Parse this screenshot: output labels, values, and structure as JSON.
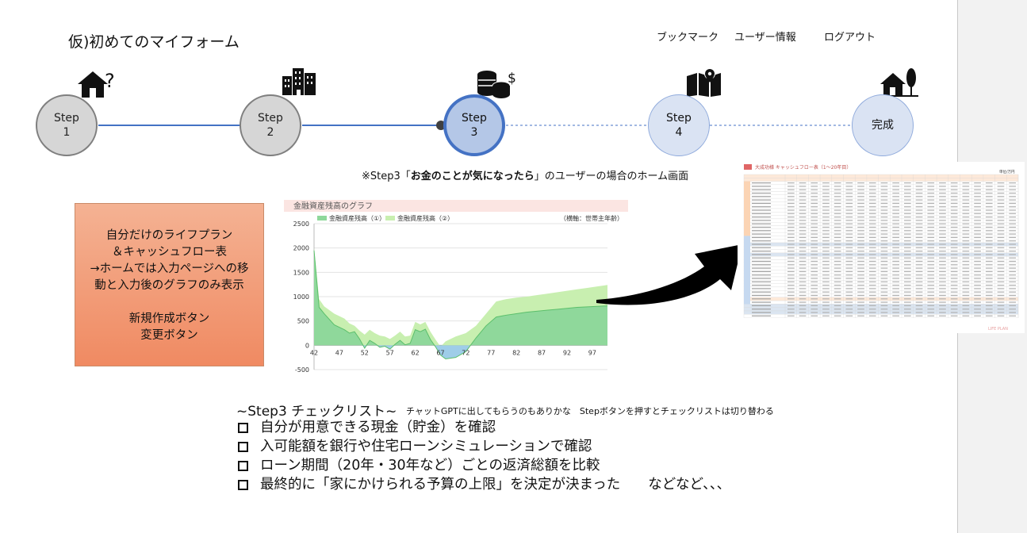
{
  "header": {
    "title": "仮)初めてのマイフォーム",
    "nav": {
      "bookmark": "ブックマーク",
      "user_info": "ユーザー情報",
      "logout": "ログアウト"
    }
  },
  "steps": [
    {
      "line1": "Step",
      "line2": "1",
      "icon": "house-question-icon",
      "state": "done"
    },
    {
      "line1": "Step",
      "line2": "2",
      "icon": "buildings-icon",
      "state": "done"
    },
    {
      "line1": "Step",
      "line2": "3",
      "icon": "coins-dollar-icon",
      "state": "current"
    },
    {
      "line1": "Step",
      "line2": "4",
      "icon": "map-pin-icon",
      "state": "upcoming"
    },
    {
      "line1": "完成",
      "line2": "",
      "icon": "house-tree-icon",
      "state": "upcoming"
    }
  ],
  "note": {
    "prefix": "※Step3「",
    "emphasis": "お金のことが気になったら",
    "suffix": "」のユーザーの場合のホーム画面"
  },
  "info_box": {
    "lines": [
      "自分だけのライフプラン",
      "＆キャッシュフロー表",
      "→ホームでは入力ページへの移",
      "動と入力後のグラフのみ表示",
      "",
      "新規作成ボタン",
      "変更ボタン"
    ]
  },
  "chart_data": {
    "type": "area",
    "title": "金融資産残高のグラフ",
    "legend": [
      "金融資産残高（①）",
      "金融資産残高（②）"
    ],
    "axis_note": "（横軸：世帯主年齢）",
    "x_ticks": [
      "42",
      "47",
      "52",
      "57",
      "62",
      "67",
      "72",
      "77",
      "82",
      "87",
      "92",
      "97"
    ],
    "y_ticks": [
      "2500",
      "2000",
      "1500",
      "1000",
      "500",
      "0",
      "-500"
    ],
    "ylim": [
      -500,
      2500
    ],
    "xlim": [
      42,
      100
    ],
    "grid": true,
    "colors": {
      "series1": "#8fd89b",
      "series2": "#c8efb0",
      "negative": "#9ecde8",
      "title_bar": "#fbe5e2"
    },
    "series": [
      {
        "name": "金融資産残高（②）",
        "x": [
          42,
          43,
          44,
          46,
          48,
          49,
          50,
          51,
          52,
          53,
          54,
          55,
          56,
          57,
          58,
          59,
          60,
          61,
          62,
          63,
          64,
          65,
          66,
          67,
          68,
          70,
          72,
          74,
          76,
          78,
          80,
          82,
          84,
          86,
          88,
          90,
          92,
          94,
          96,
          98,
          100
        ],
        "values": [
          2000,
          950,
          800,
          650,
          550,
          450,
          400,
          300,
          220,
          320,
          250,
          200,
          180,
          130,
          200,
          280,
          180,
          200,
          480,
          430,
          480,
          280,
          120,
          -30,
          80,
          180,
          250,
          400,
          650,
          900,
          950,
          980,
          1000,
          1030,
          1060,
          1090,
          1120,
          1150,
          1180,
          1210,
          1240
        ]
      },
      {
        "name": "金融資産残高（①）",
        "x": [
          42,
          43,
          44,
          46,
          48,
          49,
          50,
          51,
          52,
          53,
          54,
          55,
          56,
          57,
          58,
          59,
          60,
          61,
          62,
          63,
          64,
          65,
          66,
          67,
          68,
          70,
          72,
          74,
          76,
          78,
          80,
          82,
          84,
          86,
          88,
          90,
          92,
          94,
          96,
          98,
          100
        ],
        "values": [
          1950,
          780,
          650,
          420,
          320,
          250,
          280,
          130,
          -60,
          100,
          40,
          -40,
          -20,
          -80,
          20,
          100,
          10,
          40,
          320,
          280,
          330,
          120,
          -30,
          -200,
          -280,
          -250,
          -130,
          150,
          400,
          580,
          620,
          650,
          680,
          700,
          720,
          740,
          760,
          780,
          790,
          800,
          810
        ]
      }
    ]
  },
  "cashflow_table": {
    "title": "大成功様 キャッシュフロー表（1〜20年目）",
    "unit": "単位/万円",
    "footer": "LIFE PLAN"
  },
  "checklist": {
    "title": "~Step3 チェックリスト~",
    "note": "チャットGPTに出してもらうのもありかな　Stepボタンを押すとチェックリストは切り替わる",
    "items": [
      "自分が用意できる現金（貯金）を確認",
      "入可能額を銀行や住宅ローンシミュレーションで確認",
      "ローン期間（20年・30年など）ごとの返済総額を比較",
      "最終的に「家にかけられる予算の上限」を決定が決まった　　などなど、、、"
    ]
  }
}
